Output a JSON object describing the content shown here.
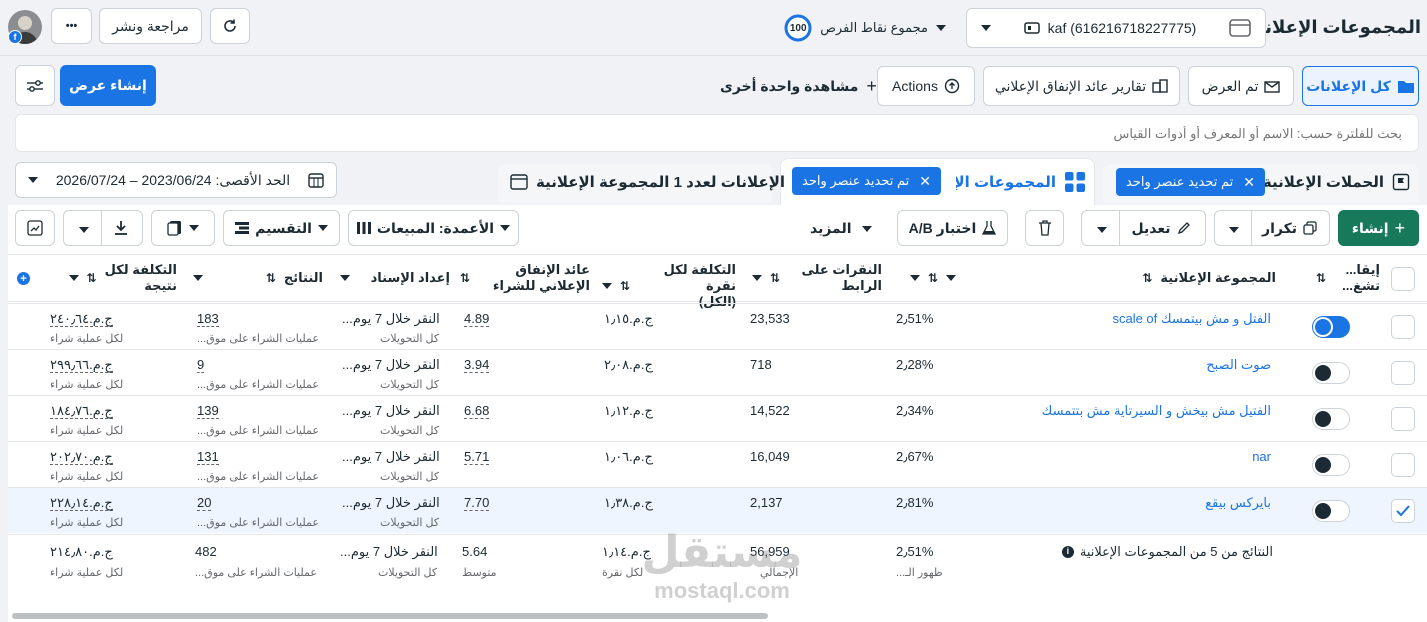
{
  "header": {
    "title": "المجموعات الإعلانية",
    "account": "kaf (616216718227775)",
    "opportunity_score": "100",
    "opportunity_label": "مجموع نقاط الفرص",
    "review_publish": "مراجعة ونشر",
    "more": "•••"
  },
  "toolbar1": {
    "all_ads": "كل الإعلانات",
    "viewed": "تم العرض",
    "roas_reports": "تقارير عائد الإنفاق الإعلاني",
    "actions": "Actions",
    "view_more": "مشاهدة واحدة أخرى",
    "create_view": "إنشاء عرض"
  },
  "search": {
    "placeholder": "بحث للفلترة حسب: الاسم أو المعرف أو أدوات القياس"
  },
  "tabs": {
    "campaigns": "الحملات الإعلانية",
    "campaigns_chip": "تم تحديد عنصر واحد",
    "adsets": "المجموعات الإع",
    "adsets_chip": "تم تحديد عنصر واحد",
    "ads": "الإعلانات لعدد 1 المجموعة الإعلانية",
    "date_range": "الحد الأقصى: 2023/06/24 – 2026/07/24"
  },
  "toolbar2": {
    "create": "إنشاء",
    "duplicate": "تكرار",
    "edit": "تعديل",
    "ab_test": "اختبار A/B",
    "more": "المزيد",
    "columns": "الأعمدة: المبيعات",
    "breakdown": "التقسيم"
  },
  "columns": {
    "toggle": "إيقا... تشغ...",
    "adset": "المجموعة الإعلانية",
    "delivery": "",
    "link_clicks_l1": "النقرات على",
    "link_clicks_l2": "الرابط",
    "cpc_l1": "التكلفة لكل نقرة",
    "cpc_l2": "(الكل)",
    "roas_l1": "عائد الإنفاق",
    "roas_l2": "الإعلاني للشراء",
    "attribution": "إعداد الإسناد",
    "results": "النتائج",
    "cpr_l1": "التكلفة لكل",
    "cpr_l2": "نتيجة"
  },
  "rows": [
    {
      "name": "الفتل و مش بيتمسك scale of",
      "on": true,
      "selected": false,
      "delivery": "2٫51%",
      "clicks": "23,533",
      "cpc": "ج.م.‏١٫١٥",
      "roas": "4.89",
      "attr": "النقر خلال 7 يوم...",
      "attr_sub": "كل التحويلات",
      "results": "183",
      "results_sub": "عمليات الشراء على موق...",
      "cpr": "ج.م.‏٢٤٠٫٦٤",
      "cpr_sub": "لكل عملية شراء"
    },
    {
      "name": "صوت الصبح",
      "on": false,
      "selected": false,
      "delivery": "2٫28%",
      "clicks": "718",
      "cpc": "ج.م.‏٢٫٠٨",
      "roas": "3.94",
      "attr": "النقر خلال 7 يوم...",
      "attr_sub": "كل التحويلات",
      "results": "9",
      "results_sub": "عمليات الشراء على موق...",
      "cpr": "ج.م.‏٢٩٩٫٦٦",
      "cpr_sub": "لكل عملية شراء"
    },
    {
      "name": "الفتيل مش بيخش و السيرتاية مش بتتمسك",
      "on": false,
      "selected": false,
      "delivery": "2٫34%",
      "clicks": "14,522",
      "cpc": "ج.م.‏١٫١٢",
      "roas": "6.68",
      "attr": "النقر خلال 7 يوم...",
      "attr_sub": "كل التحويلات",
      "results": "139",
      "results_sub": "عمليات الشراء على موق...",
      "cpr": "ج.م.‏١٨٤٫٧٦",
      "cpr_sub": "لكل عملية شراء"
    },
    {
      "name": "nar",
      "on": false,
      "selected": false,
      "delivery": "2٫67%",
      "clicks": "16,049",
      "cpc": "ج.م.‏١٫٠٦",
      "roas": "5.71",
      "attr": "النقر خلال 7 يوم...",
      "attr_sub": "كل التحويلات",
      "results": "131",
      "results_sub": "عمليات الشراء على موق...",
      "cpr": "ج.م.‏٢٠٢٫٧٠",
      "cpr_sub": "لكل عملية شراء"
    },
    {
      "name": "بايركس بيقع",
      "on": false,
      "selected": true,
      "delivery": "2٫81%",
      "clicks": "2,137",
      "cpc": "ج.م.‏١٫٣٨",
      "roas": "7.70",
      "attr": "النقر خلال 7 يوم...",
      "attr_sub": "كل التحويلات",
      "results": "20",
      "results_sub": "عمليات الشراء على موق...",
      "cpr": "ج.م.‏٢٢٨٫١٤",
      "cpr_sub": "لكل عملية شراء"
    }
  ],
  "summary": {
    "label": "النتائج من 5 من المجموعات الإعلانية",
    "delivery": "2٫51%",
    "delivery_sub": "ظهور الـ...",
    "clicks": "56,959",
    "clicks_sub": "الإجمالي",
    "cpc": "ج.م.‏١٫١٤",
    "cpc_sub": "لكل نقرة",
    "roas": "5.64",
    "roas_sub": "متوسط",
    "attr": "النقر خلال 7 يوم...",
    "attr_sub": "كل التحويلات",
    "results": "482",
    "results_sub": "عمليات الشراء على موق...",
    "cpr": "ج.م.‏٢١٤٫٨٠",
    "cpr_sub": "لكل عملية شراء"
  },
  "watermark": {
    "ar": "مستقل",
    "en": "mostaql.com"
  },
  "colors": {
    "accent": "#1b74e4",
    "create": "#18795a"
  }
}
